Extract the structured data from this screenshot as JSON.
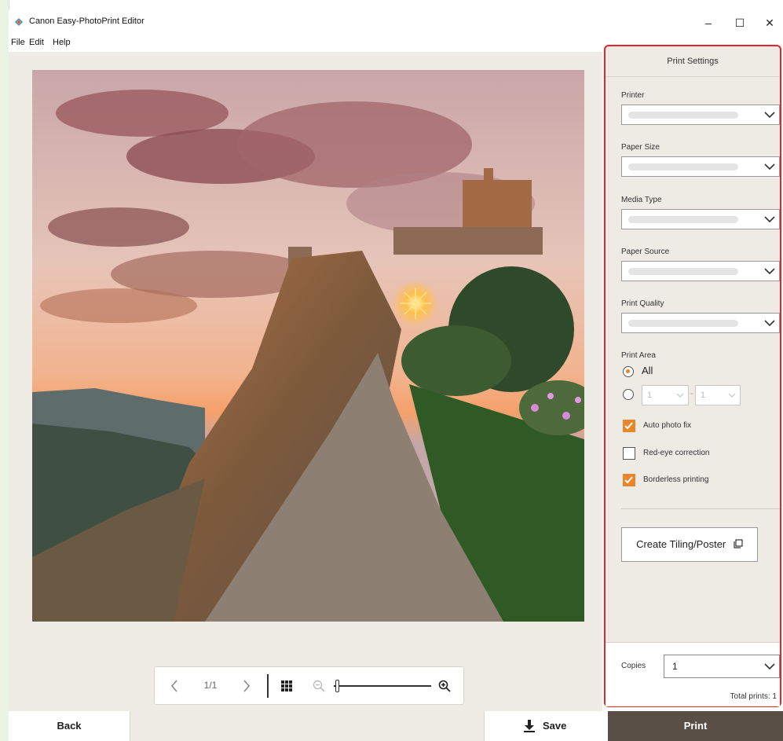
{
  "window": {
    "title": "Canon Easy-PhotoPrint Editor",
    "minimize": "–",
    "maximize": "☐",
    "close": "✕"
  },
  "menu": {
    "items": [
      "File",
      "Edit",
      "Help"
    ]
  },
  "preview": {
    "page_indicator": "1/1",
    "zoom_level": 0.02
  },
  "panel": {
    "title": "Print Settings",
    "printer_label": "Printer",
    "paper_size_label": "Paper Size",
    "media_type_label": "Media Type",
    "paper_source_label": "Paper Source",
    "print_quality_label": "Print Quality",
    "print_area_label": "Print Area",
    "print_area_all": "All",
    "range_from": "1",
    "range_dash": "-",
    "range_to": "1",
    "auto_photo_fix": "Auto photo fix",
    "red_eye_correction": "Red-eye correction",
    "borderless_printing": "Borderless printing",
    "create_tiling_poster": "Create Tiling/Poster",
    "copies_label": "Copies",
    "copies_value": "1",
    "total_prints": "Total prints: 1"
  },
  "buttons": {
    "back": "Back",
    "save": "Save",
    "print": "Print"
  },
  "colors": {
    "accent": "#e8862a",
    "highlight_border": "#e3262b",
    "print_button": "#5a4f46"
  }
}
